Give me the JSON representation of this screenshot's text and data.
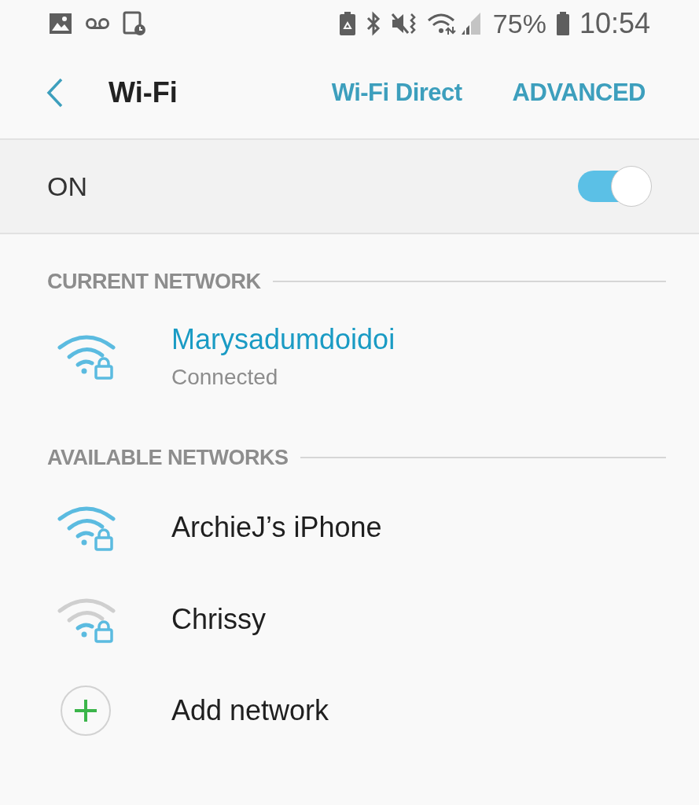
{
  "status_bar": {
    "battery_percent": "75%",
    "time": "10:54"
  },
  "header": {
    "title": "Wi-Fi",
    "actions": [
      "Wi-Fi Direct",
      "ADVANCED"
    ]
  },
  "master_switch": {
    "label": "ON",
    "on": true
  },
  "current_network": {
    "heading": "CURRENT NETWORK",
    "name": "Marysadumdoidoi",
    "status": "Connected",
    "weak": false
  },
  "available_networks": {
    "heading": "AVAILABLE NETWORKS",
    "items": [
      {
        "name": "ArchieJ’s iPhone",
        "weak": false
      },
      {
        "name": "Chrissy",
        "weak": true
      }
    ],
    "add": "Add network"
  }
}
